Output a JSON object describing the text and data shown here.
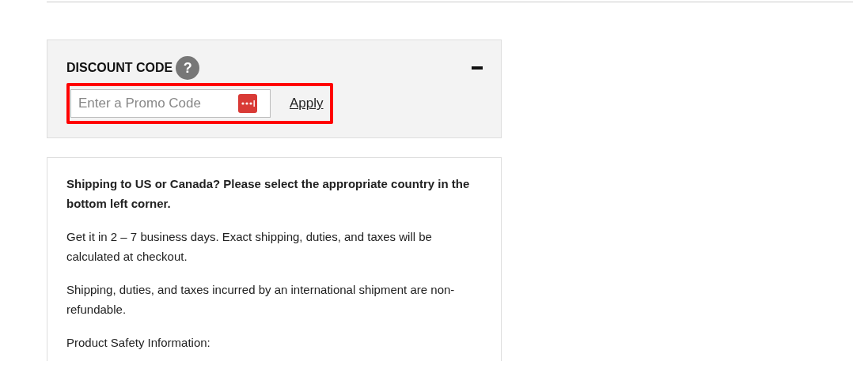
{
  "discount": {
    "title": "DISCOUNT CODE",
    "help": "?",
    "expanded": true,
    "highlighted": true,
    "field": {
      "placeholder": "Enter a Promo Code"
    },
    "apply": "Apply"
  },
  "info": {
    "paragraphs": [
      {
        "kind": "bold",
        "text": "Shipping to US or Canada? Please select the appropriate country in the bottom left corner."
      },
      {
        "kind": "plain",
        "text": "Get it in 2 – 7 business days. Exact shipping, duties, and taxes will be calculated at checkout."
      },
      {
        "kind": "plain",
        "text": "Shipping, duties, and taxes incurred by an international shipment are non-refundable."
      },
      {
        "kind": "plain",
        "text": "Product Safety Information:"
      }
    ]
  }
}
